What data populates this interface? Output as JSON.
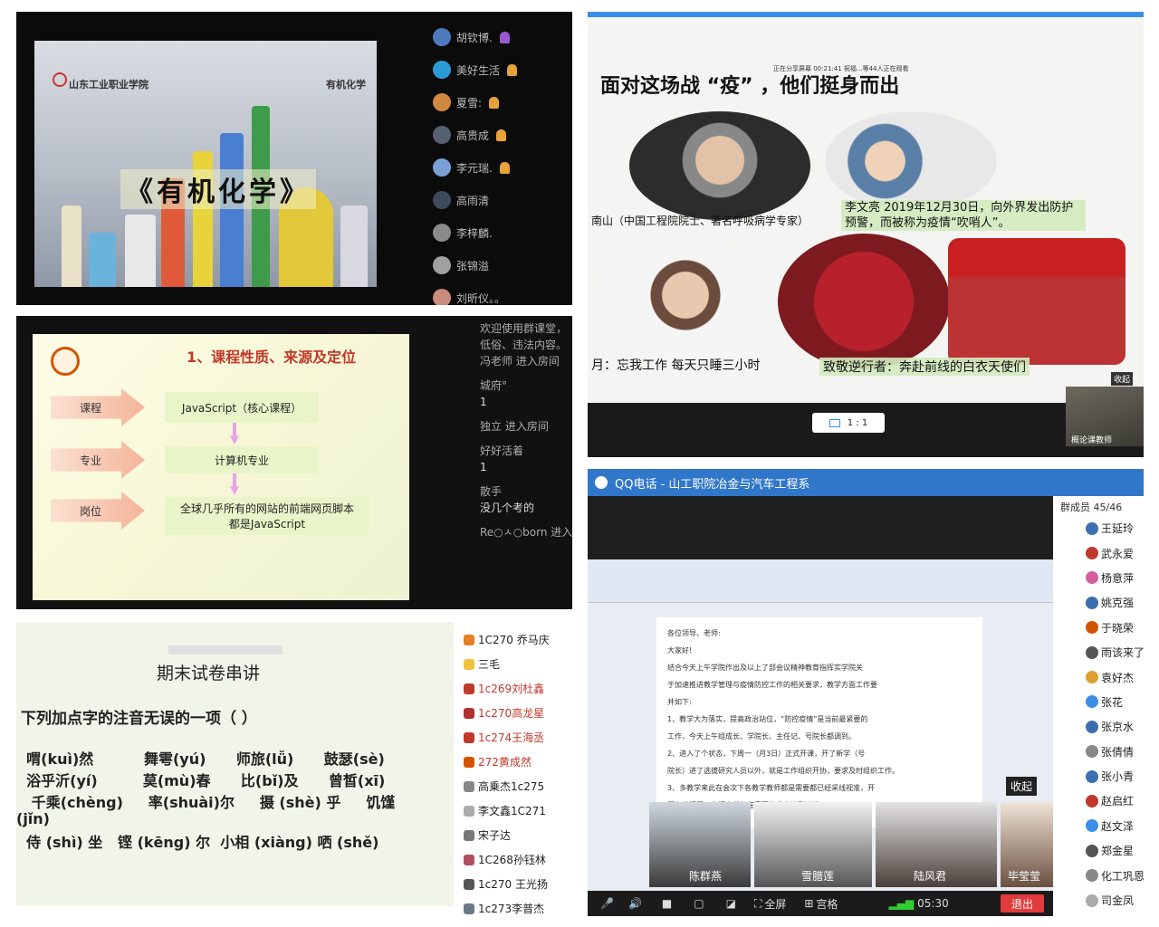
{
  "panel1": {
    "school": "山东工业职业学院",
    "subject": "有机化学",
    "title": "《有机化学》",
    "participants": [
      "胡钦博.",
      "美好生活",
      "夏雪:",
      "高贵成",
      "李元瑞.",
      "高雨清",
      "李梓麟.",
      "张锦溢",
      "刘昕仪。。"
    ]
  },
  "panel2": {
    "share_status": "正在分享屏幕    00:21:41        祝福...等44人正在观看",
    "heading": "面对这场战 “疫” ，他们挺身而出",
    "cap_zhong": "南山（中国工程院院士、著名呼吸病学专家）",
    "cap_li": "李文亮 2019年12月30日，向外界发出防护预警，而被称为疫情“吹哨人”。",
    "cap_zhang": "月：忘我工作 每天只睡三小时",
    "cap_team": "致敬逆行者：奔赴前线的白衣天使们",
    "collapse": "收起",
    "page": "1 : 1",
    "teacher_label": "概论课教师"
  },
  "panel3": {
    "title": "1、课程性质、来源及定位",
    "rows": [
      {
        "label": "课程",
        "box": "JavaScript（核心课程）"
      },
      {
        "label": "专业",
        "box": "计算机专业"
      },
      {
        "label": "岗位",
        "box": "全球几乎所有的网站的前端网页脚本都是JavaScript"
      }
    ],
    "chat": [
      "欢迎使用群课堂，",
      "低俗、违法内容。",
      "冯老师 进入房间",
      "",
      "城府°",
      "1",
      "",
      "独立 进入房间",
      "",
      "好好活着",
      "1",
      "",
      "散手",
      "没几个考的",
      "",
      "Re○ㅅ○born 进入"
    ]
  },
  "panel4": {
    "title": "期末试卷串讲",
    "question": "下列加点字的注音无误的一项（    ）",
    "lines": [
      "  喟(kuì)然          舞雩(yú)      师旅(lǚ)      鼓瑟(sè)",
      "  浴乎沂(yí)         莫(mù)春      比(bǐ)及      曾皙(xī)",
      "   千乘(chèng)     率(shuài)尔     摄 (shè) 乎     饥馑",
      "(jǐn)",
      "  侍 (shì) 坐   铿 (kēng) 尔  小相 (xiàng) 哂 (shě)"
    ],
    "students": [
      "1C270 乔马庆",
      "三毛",
      "1c269刘杜鑫",
      "1c270高龙星",
      "1c274王海丞",
      "272黄成然",
      "高乗杰1c275",
      "李文鑫1C271",
      "宋子达",
      "1C268孙钰林",
      "1c270 王光扬",
      "1c273李普杰"
    ]
  },
  "panel5": {
    "title": "QQ电话 - 山工职院冶金与汽车工程系",
    "member_count": "群成员 45/46",
    "members": [
      "王延玲",
      "武永爱",
      "杨意萍",
      "姚克强",
      "于晓荣",
      "雨该来了",
      "袁好杰",
      "张花",
      "张京水",
      "张倩倩",
      "张小青",
      "赵启红",
      "赵文泽",
      "郑金星",
      "化工巩恩",
      "司金凤"
    ],
    "doc_lines": [
      "各位领导、老师:",
      "大家好!",
      "结合今天上午学院作出及以上了部会议精神教育指挥实学院关",
      "于加速推进教学管理与疫情防控工作的相关要求，教学方面工作要",
      "并如下:",
      "1、教学大为落实，提高政治站位，“防控疫情”是当前最紧要的",
      "工作，今天上午组成长、学院长、主任记、号院长都调到。",
      "2、进入了个状态，下周一（月3日）正式开课，开了新学（号",
      "院长）进了选拔研究人员以外，就是工作组织开协，要求及时组织工作。",
      "3、多教学来此在会次下各教学教师都是需要都已经采线视准，开",
      "隔有关问题，有间表就不在需要的今天接到改进。"
    ],
    "videos": [
      "陈群燕",
      "雪腊莲",
      "陆风君",
      "毕莹莹"
    ],
    "collapse": "收起",
    "fullscreen": "全屏",
    "grid": "宫格",
    "time": "05:30",
    "exit": "退出"
  }
}
